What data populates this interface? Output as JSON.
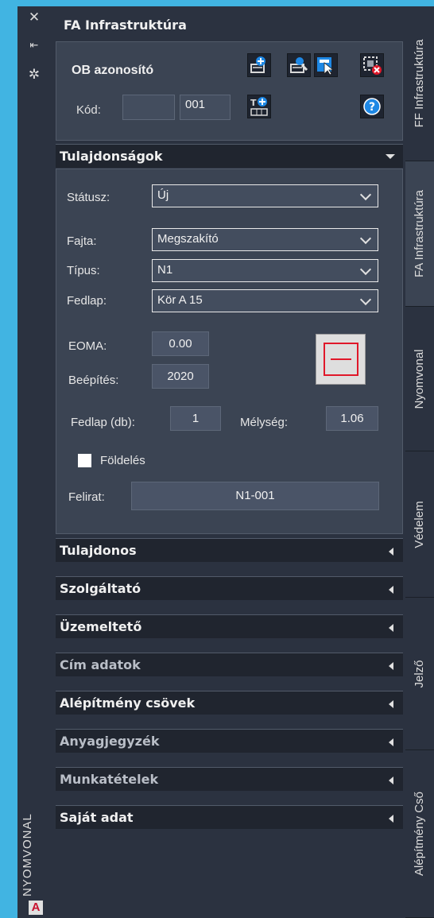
{
  "left_strip": {
    "close_icon": "close-icon",
    "pin_icon": "pin-icon",
    "settings_icon": "gear-icon",
    "title": "NYOMVONAL",
    "app_badge": "A"
  },
  "panel": {
    "title": "FA Infrastruktúra"
  },
  "ob": {
    "label": "OB azonosító",
    "kod_label": "Kód:",
    "kod_prefix": "",
    "kod_value": "001"
  },
  "sections": {
    "tulajdonsagok": "Tulajdonságok",
    "items": [
      {
        "label": "Tulajdonos",
        "dim": false
      },
      {
        "label": "Szolgáltató",
        "dim": false
      },
      {
        "label": "Üzemeltető",
        "dim": false
      },
      {
        "label": "Cím adatok",
        "dim": true
      },
      {
        "label": "Alépítmény csövek",
        "dim": false
      },
      {
        "label": "Anyagjegyzék",
        "dim": true
      },
      {
        "label": "Munkatételek",
        "dim": true
      },
      {
        "label": "Saját adat",
        "dim": false
      }
    ]
  },
  "props": {
    "statusz_label": "Státusz:",
    "statusz_value": "Új",
    "fajta_label": "Fajta:",
    "fajta_value": "Megszakító",
    "tipus_label": "Típus:",
    "tipus_value": "N1",
    "fedlap_label": "Fedlap:",
    "fedlap_value": "Kör A 15",
    "eoma_label": "EOMA:",
    "eoma_value": "0.00",
    "beepites_label": "Beépítés:",
    "beepites_value": "2020",
    "fedlap_db_label": "Fedlap (db):",
    "fedlap_db_value": "1",
    "melyseg_label": "Mélység:",
    "melyseg_value": "1.06",
    "foldeles_label": "Földelés",
    "felirat_label": "Felirat:",
    "felirat_value": "N1-001"
  },
  "vtabs": [
    {
      "label": "FF Infrastruktúra",
      "active": false
    },
    {
      "label": "FA Infrastruktúra",
      "active": true
    },
    {
      "label": "Nyomvonal",
      "active": false
    },
    {
      "label": "Védelem",
      "active": false
    },
    {
      "label": "Jelző",
      "active": false
    },
    {
      "label": "Alépítmény Cső",
      "active": false
    }
  ],
  "colors": {
    "background_desktop": "#41b4e2",
    "panel": "#2b3240",
    "section_body": "#3b4453",
    "header": "#20252f",
    "accent_red": "#e0182a",
    "help_blue": "#1e88e5"
  }
}
